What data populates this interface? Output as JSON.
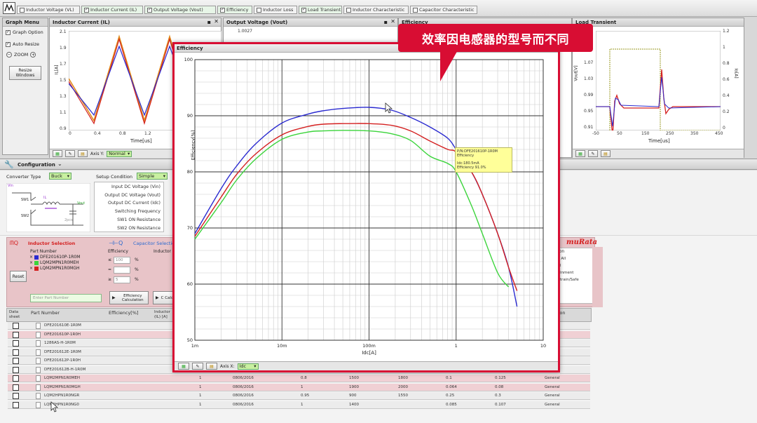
{
  "tabs": [
    {
      "label": "Inductor Voltage (VL)",
      "checked": false
    },
    {
      "label": "Inductor Current (IL)",
      "checked": true
    },
    {
      "label": "Output Voltage (Vout)",
      "checked": true
    },
    {
      "label": "Efficiency",
      "checked": true
    },
    {
      "label": "Inductor Loss",
      "checked": false
    },
    {
      "label": "Load Transient",
      "checked": true
    },
    {
      "label": "Inductor Characteristic",
      "checked": false
    },
    {
      "label": "Capacitor Characteristic",
      "checked": false
    }
  ],
  "graph_menu": {
    "title": "Graph Menu",
    "graph_option": "Graph Option",
    "auto_resize": "Auto Resize",
    "zoom": "ZOOM",
    "resize_windows": "Resize Windows"
  },
  "plots": {
    "inductor_current": {
      "title": "Inductor Current (IL)",
      "ylabel": "IL[A]",
      "xlabel": "Time[us]",
      "yticks": [
        "2.1",
        "1.9",
        "1.7",
        "1.5",
        "1.3",
        "1.1",
        "0.9"
      ],
      "xticks": [
        "0",
        "0.4",
        "0.8",
        "1.2"
      ]
    },
    "output_voltage": {
      "title": "Output Voltage (Vout)",
      "yticks": [
        "1.0027"
      ]
    },
    "efficiency_bg": {
      "title": "Efficiency"
    },
    "load_transient": {
      "title": "Load Transient",
      "ylabel": "Vout[V]",
      "ylabel2": "Io[A]",
      "xlabel": "Time[us]",
      "yticks": [
        "1.07",
        "1.03",
        "0.99",
        "0.95",
        "0.91"
      ],
      "yticks2": [
        "1.2",
        "1",
        "0.8",
        "0.6",
        "0.4",
        "0.2",
        "0"
      ],
      "xticks": [
        "-50",
        "50",
        "150",
        "250",
        "350",
        "450"
      ]
    },
    "axis_y": {
      "label": "Axis Y:",
      "value": "Normal"
    }
  },
  "config": {
    "title": "Configuration",
    "converter_type_label": "Converter Type",
    "converter_type": "Buck",
    "setup_condition_label": "Setup Condition",
    "setup_condition": "Simple",
    "fields": [
      "Input DC Voltage (Vin)",
      "Output DC Voltage (Vout)",
      "Output DC Current (Idc)",
      "Switching Frequency",
      "SW1 ON Resistance",
      "SW2 ON Resistance"
    ],
    "schematic_labels": {
      "vin": "Vin",
      "sw1": "SW1",
      "sw2": "SW2",
      "vout": "Vout",
      "pcs": "2pcs",
      "il": "IL"
    }
  },
  "inductor_selection": {
    "title": "Inductor Selection",
    "capacitor_tab": "Capacitor Selection",
    "part_number_header": "Part Number",
    "efficiency_header": "Efficiency",
    "inductor_header": "Inductor",
    "selected_parts": [
      {
        "name": "DFE201610P-1R0M",
        "color": "#2a2ad0"
      },
      {
        "name": "LQM2MPN1R0MEH",
        "color": "#3bd43b"
      },
      {
        "name": "LQM2MPN1R0MGH",
        "color": "#d42020"
      }
    ],
    "eff_inputs": [
      "100",
      "",
      "5"
    ],
    "pct": "%",
    "reset": "Reset",
    "enter_part": "Enter Part Number",
    "eff_calc": "Efficiency Calculation",
    "calc_short": "C Calc",
    "brand": "muRata",
    "right_col": {
      "header": "ation",
      "items": [
        "ect All",
        "eral",
        "ntainment",
        "vertrain/Safe"
      ]
    }
  },
  "table": {
    "headers": [
      "Data sheet",
      "Part Number",
      "Efficiency[%]",
      "Inductor (IL) [A]",
      "ation"
    ],
    "rows": [
      {
        "part": "DFE201610E-1R0M",
        "highlight": false,
        "cols": []
      },
      {
        "part": "DFE201610P-1R0H",
        "highlight": true,
        "cols": []
      },
      {
        "part": "1286AS-H-1R0M",
        "highlight": false,
        "cols": []
      },
      {
        "part": "DFE201612E-1R0M",
        "highlight": false,
        "cols": []
      },
      {
        "part": "DFE201612P-1R0H",
        "highlight": false,
        "cols": []
      },
      {
        "part": "DFE201612B-H-1R0M",
        "highlight": false,
        "cols": []
      },
      {
        "part": "LQM2MPN1R0MEH",
        "highlight": true,
        "cols": [
          "1",
          "0806/2016",
          "0.8",
          "1500",
          "1800",
          "0.1",
          "0.125",
          "General"
        ]
      },
      {
        "part": "LQM2MPN1R0MGH",
        "highlight": true,
        "cols": [
          "1",
          "0806/2016",
          "1",
          "1900",
          "2000",
          "0.064",
          "0.08",
          "General"
        ]
      },
      {
        "part": "LQM2HPN1R0NGR",
        "highlight": false,
        "cols": [
          "1",
          "0806/2016",
          "0.95",
          "900",
          "1550",
          "0.25",
          "0.3",
          "General"
        ]
      },
      {
        "part": "LQM2HPN1R0NG0",
        "highlight": false,
        "cols": [
          "1",
          "0806/2016",
          "1",
          "1400",
          "",
          "0.085",
          "0.107",
          "General"
        ]
      }
    ]
  },
  "dialog": {
    "title": "Efficiency",
    "tooltip": {
      "pn": "P/N:DFE201610P-1R0M",
      "metric": "Efficiency",
      "idc": "Idc:180.5mA",
      "eff": "Efficiency 91.0%"
    },
    "axis_x_label": "Axis X:",
    "axis_x_value": "Idc"
  },
  "banner": "效率因电感器的型号而不同",
  "chart_data": {
    "type": "line",
    "xlabel": "Idc[A]",
    "ylabel": "Efficiency[%]",
    "xscale": "log",
    "xlim": [
      0.001,
      10
    ],
    "ylim": [
      50,
      100
    ],
    "x_ticks": [
      "1m",
      "10m",
      "100m",
      "1",
      "10"
    ],
    "y_ticks": [
      "50",
      "60",
      "70",
      "80",
      "90",
      "100"
    ],
    "grid": true,
    "x": [
      0.001,
      0.002,
      0.003,
      0.005,
      0.01,
      0.02,
      0.03,
      0.05,
      0.1,
      0.18,
      0.3,
      0.5,
      0.8,
      1,
      1.5,
      2,
      3,
      4,
      5
    ],
    "series": [
      {
        "name": "DFE201610P-1R0M",
        "color": "#2a2ad0",
        "values": [
          69,
          77,
          81,
          85,
          88.7,
          90.3,
          90.9,
          91.3,
          91.5,
          91.0,
          89.7,
          88.0,
          86.0,
          84,
          80,
          76,
          69,
          63,
          56
        ]
      },
      {
        "name": "LQM2MPN1R0MGH",
        "color": "#d42020",
        "values": [
          68.5,
          75.5,
          79.5,
          83.2,
          86.6,
          88.1,
          88.5,
          88.6,
          88.6,
          88.3,
          87.3,
          85.5,
          84.0,
          83.5,
          80,
          76,
          69,
          63,
          58.8
        ]
      },
      {
        "name": "LQM2MPN1R0MEH",
        "color": "#3bd43b",
        "values": [
          68,
          74.5,
          78.5,
          82.3,
          85.8,
          87.1,
          87.3,
          87.4,
          87.3,
          86.8,
          85.6,
          82.8,
          81.5,
          80,
          74,
          69,
          62,
          59.5,
          null
        ]
      }
    ]
  }
}
